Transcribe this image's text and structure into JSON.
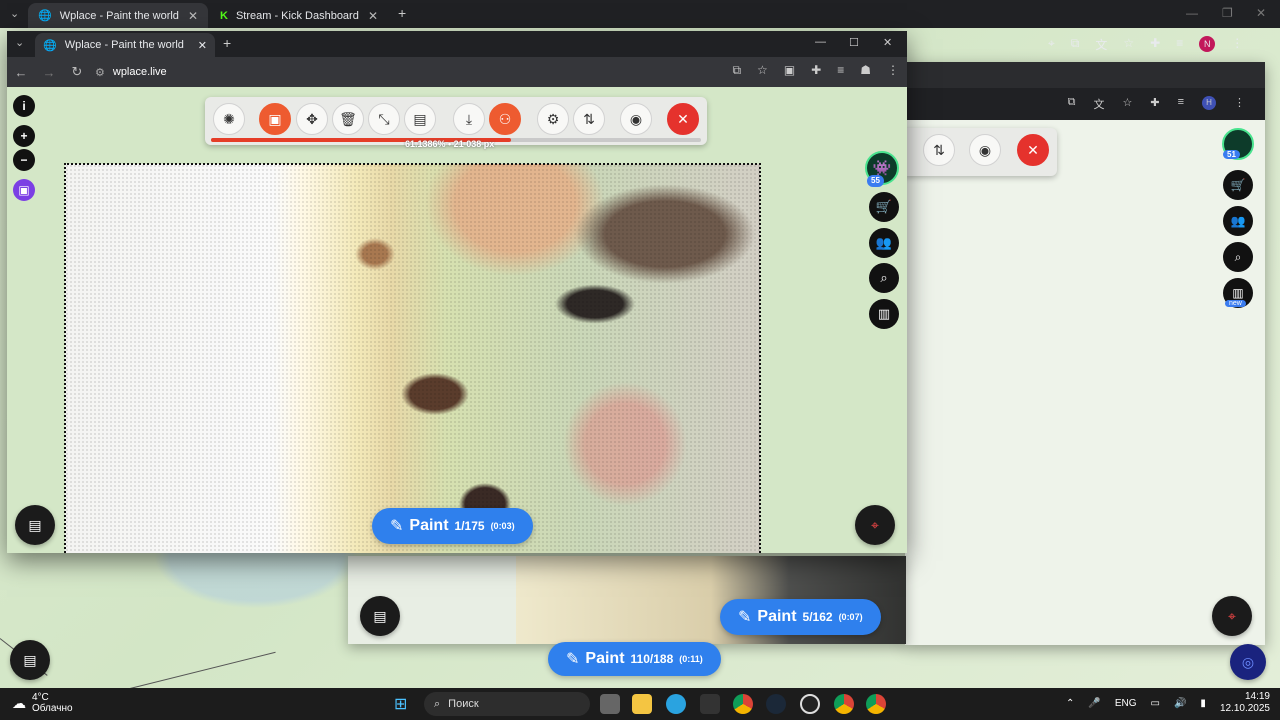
{
  "outer_browser": {
    "tabs": [
      {
        "label": "Wplace - Paint the world",
        "icon": "globe-icon"
      },
      {
        "label": "Stream - Kick Dashboard",
        "icon": "kick-icon"
      }
    ]
  },
  "inner_browser": {
    "tab": {
      "label": "Wplace - Paint the world",
      "icon": "globe-icon"
    },
    "url": "wplace.live"
  },
  "toolbar": {
    "progress_text": "61.1386% • 21 038 px",
    "progress_percent": 61.1386,
    "buttons": [
      "bug-icon",
      "image-icon",
      "move-icon",
      "trash-icon",
      "resize-icon",
      "copy-icon",
      "download-icon",
      "robot-icon",
      "gear-icon",
      "sort-icon",
      "discord-icon",
      "close-icon"
    ]
  },
  "left_controls": [
    "info-icon",
    "zoom-in-icon",
    "zoom-out-icon",
    "twitch-icon"
  ],
  "right_controls": {
    "avatar_badge": "55",
    "items": [
      "cart-icon",
      "people-icon",
      "search-icon",
      "leaderboard-icon"
    ]
  },
  "mid_window": {
    "avatar_badge": "51",
    "new_badge": "new"
  },
  "paint_buttons": [
    {
      "label": "Paint",
      "count": "1/175",
      "time": "(0:03)"
    },
    {
      "label": "Paint",
      "count": "5/162",
      "time": "(0:07)"
    },
    {
      "label": "Paint",
      "count": "110/188",
      "time": "(0:11)"
    }
  ],
  "taskbar": {
    "weather_temp": "4°C",
    "weather_desc": "Облачно",
    "search_placeholder": "Поиск",
    "language": "ENG",
    "time": "14:19",
    "date": "12.10.2025"
  },
  "colors": {
    "accent_blue": "#2f80ed",
    "toolbar_orange": "#ee5b30",
    "close_red": "#e5322d",
    "progress_red": "#e53d28"
  }
}
